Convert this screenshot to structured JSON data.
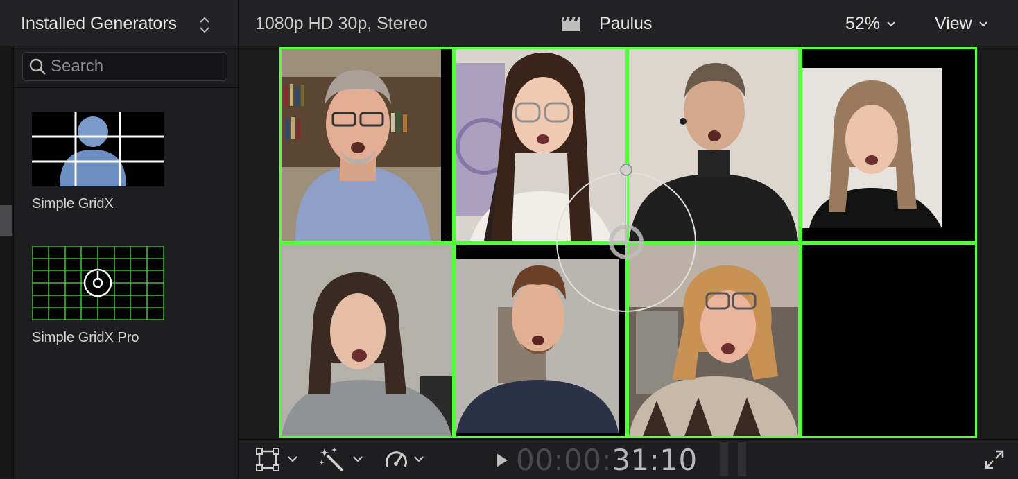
{
  "sidebar": {
    "title": "Installed Generators",
    "search_placeholder": "Search",
    "generators": [
      {
        "label": "Simple GridX",
        "icon": "silhouette-grid-icon"
      },
      {
        "label": "Simple GridX Pro",
        "icon": "green-grid-target-icon"
      }
    ]
  },
  "viewer_header": {
    "format": "1080p HD 30p, Stereo",
    "project": "Paulus",
    "project_icon": "clapperboard-icon",
    "zoom": "52%",
    "view_menu": "View"
  },
  "viewer": {
    "grid_color": "#53ff3a",
    "cells": [
      {
        "name": "cell-1",
        "subject": "man with glasses, bookshelf background"
      },
      {
        "name": "cell-2",
        "subject": "young woman with glasses"
      },
      {
        "name": "cell-3",
        "subject": "man in black turtleneck"
      },
      {
        "name": "cell-4",
        "subject": "woman with shoulder-length hair"
      },
      {
        "name": "cell-5",
        "subject": "woman in grey hoodie"
      },
      {
        "name": "cell-6",
        "subject": "young man in navy t-shirt"
      },
      {
        "name": "cell-7",
        "subject": "woman with curly hair and glasses"
      },
      {
        "name": "cell-8",
        "subject": "empty"
      }
    ]
  },
  "transport": {
    "timecode_dim": "00:00:",
    "timecode_lit": "31:10",
    "tools": [
      "transform-tool-icon",
      "enhance-wand-icon",
      "retime-speed-icon"
    ]
  }
}
